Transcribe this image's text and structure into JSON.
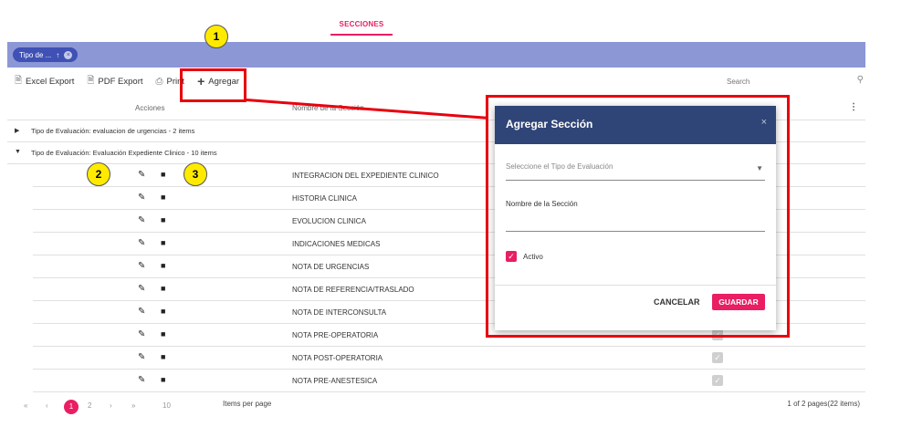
{
  "tabs": {
    "secciones": "SECCIONES"
  },
  "group_bar": {
    "chip_label": "Tipo de ...",
    "chip_sort": "↑",
    "chip_remove": "×"
  },
  "toolbar": {
    "excel": "Excel Export",
    "pdf": "PDF Export",
    "print": "Print",
    "add": "Agregar",
    "search_placeholder": "Search"
  },
  "grid": {
    "columns": {
      "acciones": "Acciones",
      "nombre": "Nombre de la Sección"
    },
    "groups": [
      {
        "label": "Tipo de Evaluación: evaluacion de urgencias - 2 items",
        "expanded": false
      },
      {
        "label": "Tipo de Evaluación: Evaluación Expediente Clinico - 10 items",
        "expanded": true
      }
    ],
    "rows": [
      "INTEGRACION DEL EXPEDIENTE CLINICO",
      "HISTORIA CLINICA",
      "EVOLUCION CLINICA",
      "INDICACIONES MEDICAS",
      "NOTA DE URGENCIAS",
      "NOTA DE REFERENCIA/TRASLADO",
      "NOTA DE INTERCONSULTA",
      "NOTA PRE-OPERATORIA",
      "NOTA POST-OPERATORIA",
      "NOTA PRE-ANESTESICA"
    ]
  },
  "pager": {
    "first": "«",
    "prev": "‹",
    "page1": "1",
    "page2": "2",
    "next": "›",
    "last": "»",
    "page_size": "10",
    "items_per_page": "Items per page",
    "info": "1 of 2 pages(22 items)"
  },
  "dialog": {
    "title": "Agregar Sección",
    "close": "×",
    "select_placeholder": "Seleccione el Tipo de Evaluación",
    "nombre_label": "Nombre de la Sección",
    "activo_label": "Activo",
    "cancel": "CANCELAR",
    "save": "GUARDAR"
  },
  "callouts": [
    "1",
    "2",
    "3"
  ],
  "colors": {
    "accent": "#e91e63",
    "header_bar": "#8c97d6",
    "dialog_header": "#2f4577",
    "annotation": "#e8000e",
    "callout": "#ffea00"
  }
}
